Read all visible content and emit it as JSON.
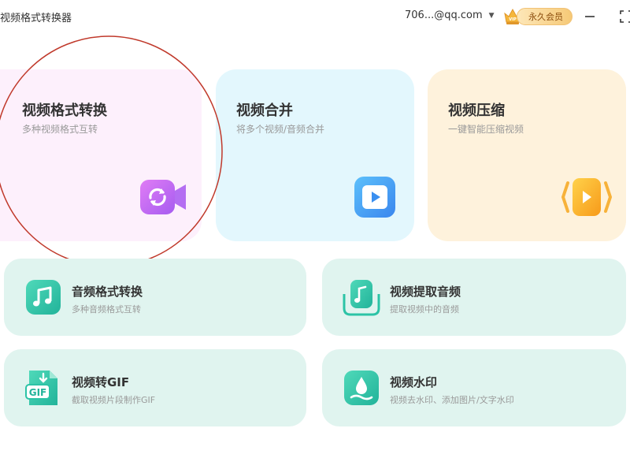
{
  "window": {
    "title": "视频格式转换器",
    "account": "706...@qq.com",
    "vip_label": "永久会员",
    "crown_badge": "VIP"
  },
  "top_cards": [
    {
      "title": "视频格式转换",
      "subtitle": "多种视频格式互转",
      "icon": "video-convert-icon",
      "color": "#b066f0"
    },
    {
      "title": "视频合并",
      "subtitle": "将多个视频/音频合并",
      "icon": "play-icon",
      "color": "#3d9ef5"
    },
    {
      "title": "视频压缩",
      "subtitle": "一键智能压缩视频",
      "icon": "compress-icon",
      "color": "#f7a01a"
    }
  ],
  "feature_cards": [
    {
      "title": "音频格式转换",
      "subtitle": "多种音频格式互转",
      "icon": "music-note-icon"
    },
    {
      "title": "视频提取音频",
      "subtitle": "提取视频中的音频",
      "icon": "extract-audio-icon"
    },
    {
      "title": "视频转GIF",
      "subtitle": "截取视频片段制作GIF",
      "icon": "gif-file-icon",
      "badge": "GIF"
    },
    {
      "title": "视频水印",
      "subtitle": "视频去水印、添加图片/文字水印",
      "icon": "watermark-icon"
    }
  ],
  "colors": {
    "accent_green": "#2cc3a6",
    "card_green_bg": "#e0f4ef",
    "annotation": "#c0392b"
  }
}
